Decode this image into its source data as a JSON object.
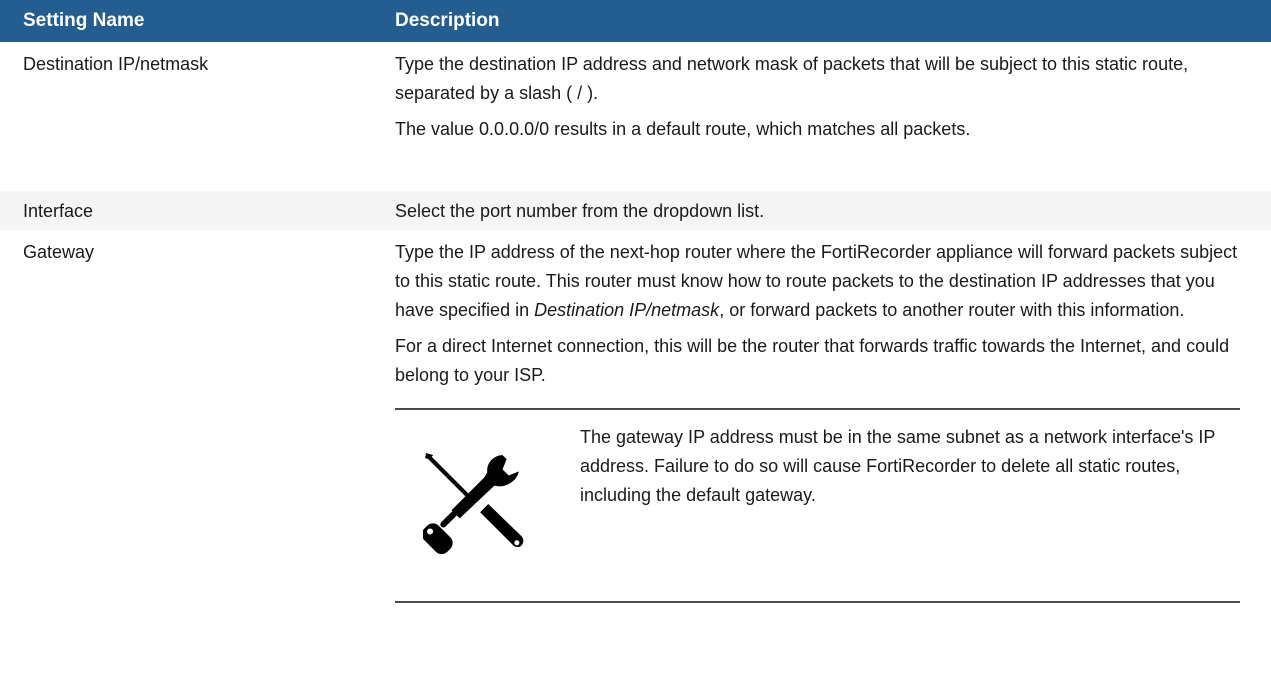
{
  "table": {
    "headers": {
      "setting_name": "Setting Name",
      "description": "Description"
    },
    "rows": [
      {
        "name": "Destination IP/netmask",
        "desc_p1": "Type the destination IP address and network mask of packets that will be subject to this static route, separated by a slash ( / ).",
        "desc_p2": "The value 0.0.0.0/0 results in a default route, which matches all packets."
      },
      {
        "name": "Interface",
        "desc_p1": "Select the port number from the dropdown list."
      },
      {
        "name": "Gateway",
        "desc_p1_before": "Type the IP address of the next-hop router where the FortiRecorder appliance will forward packets subject to this static route. This router must know how to route packets to the destination IP addresses that you have specified in ",
        "desc_p1_em": "Destination IP/netmask",
        "desc_p1_after": ", or forward packets to another router with this information.",
        "desc_p2": "For a direct Internet connection, this will be the router that forwards traffic towards the Internet, and could belong to your ISP.",
        "note": {
          "icon": "tools-icon",
          "text": "The gateway IP address must be in the same subnet as a network interface's IP address. Failure to do so will cause FortiRecorder to delete all static routes, including the default gateway."
        }
      }
    ]
  }
}
